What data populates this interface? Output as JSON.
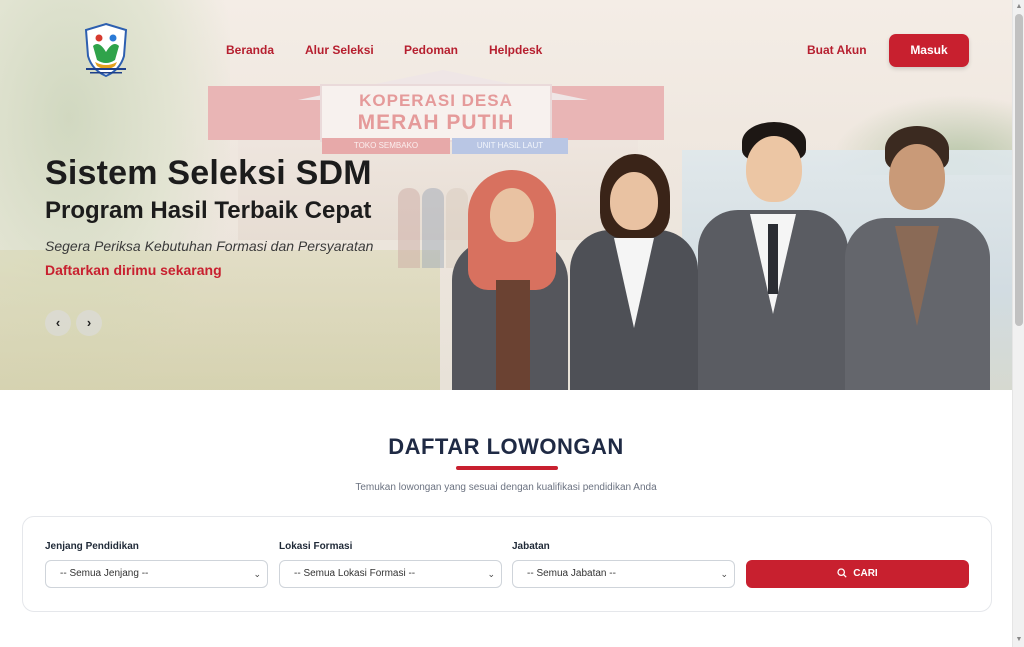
{
  "nav": {
    "links": [
      "Beranda",
      "Alur Seleksi",
      "Pedoman",
      "Helpdesk"
    ],
    "signup": "Buat Akun",
    "login": "Masuk"
  },
  "hero": {
    "store_sign_line1": "KOPERASI DESA",
    "store_sign_line2": "MERAH PUTIH",
    "store_sub1": "TOKO SEMBAKO",
    "store_sub2": "UNIT HASIL LAUT",
    "title": "Sistem Seleksi SDM",
    "subtitle": "Program Hasil Terbaik Cepat",
    "description": "Segera Periksa Kebutuhan Formasi dan Persyaratan",
    "cta": "Daftarkan dirimu sekarang",
    "prev_icon": "‹",
    "next_icon": "›"
  },
  "section": {
    "title": "DAFTAR LOWONGAN",
    "description": "Temukan lowongan yang sesuai dengan kualifikasi pendidikan Anda"
  },
  "filters": {
    "education": {
      "label": "Jenjang Pendidikan",
      "value": "-- Semua Jenjang --"
    },
    "location": {
      "label": "Lokasi Formasi",
      "value": "-- Semua Lokasi Formasi --"
    },
    "position": {
      "label": "Jabatan",
      "value": "-- Semua Jabatan --"
    },
    "search_button": "CARI"
  },
  "colors": {
    "brand_red": "#c8202f",
    "nav_link_red": "#b61f2f",
    "heading_dark": "#1f2a44"
  }
}
